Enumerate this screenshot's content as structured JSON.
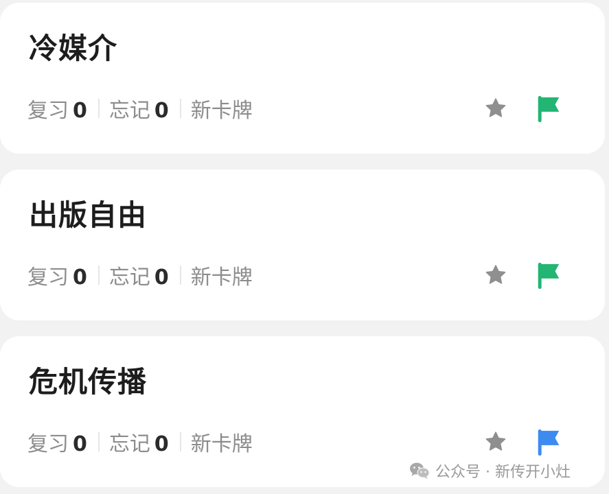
{
  "decks": [
    {
      "title": "冷媒介",
      "review_label": "复习",
      "review_count": "0",
      "forget_label": "忘记",
      "forget_count": "0",
      "new_label": "新卡牌",
      "star_color": "#8f8f8f",
      "flag_color": "#22b573"
    },
    {
      "title": "出版自由",
      "review_label": "复习",
      "review_count": "0",
      "forget_label": "忘记",
      "forget_count": "0",
      "new_label": "新卡牌",
      "star_color": "#8f8f8f",
      "flag_color": "#22b573"
    },
    {
      "title": "危机传播",
      "review_label": "复习",
      "review_count": "0",
      "forget_label": "忘记",
      "forget_count": "0",
      "new_label": "新卡牌",
      "star_color": "#8f8f8f",
      "flag_color": "#3d8bf0"
    }
  ],
  "watermark": {
    "text": "公众号 · 新传开小灶",
    "icon": "wechat-icon"
  },
  "colors": {
    "background": "#f2f2f2",
    "card": "#ffffff",
    "title": "#1d1d1d",
    "muted": "#8c8c8c"
  }
}
